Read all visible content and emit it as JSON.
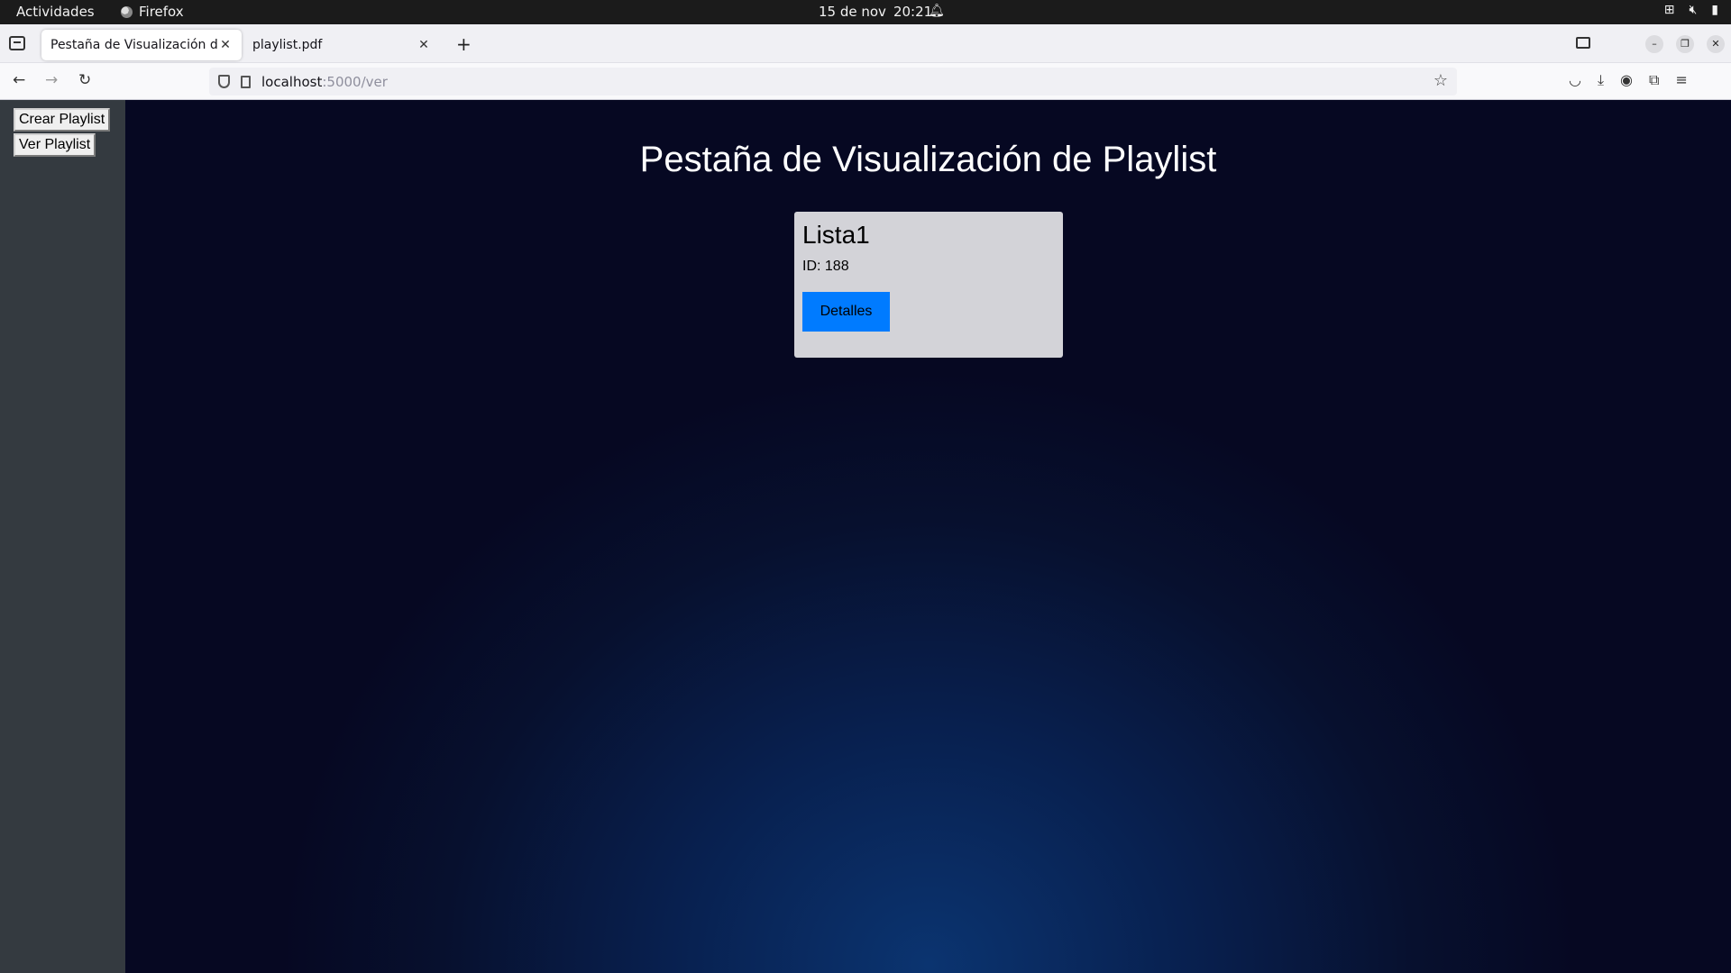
{
  "system_bar": {
    "activities": "Actividades",
    "app_name": "Firefox",
    "date": "15 de nov",
    "time": "20:21"
  },
  "browser": {
    "tabs": [
      {
        "title": "Pestaña de Visualización de Playlist",
        "active": true
      },
      {
        "title": "playlist.pdf",
        "active": false
      }
    ],
    "url_host": "localhost",
    "url_path": ":5000/ver"
  },
  "sidebar": {
    "create_label": "Crear Playlist",
    "view_label": "Ver Playlist"
  },
  "main": {
    "title": "Pestaña de Visualización de Playlist",
    "playlists": [
      {
        "name": "Lista1",
        "id_text": "ID: 188",
        "details_label": "Detalles"
      }
    ]
  },
  "colors": {
    "button_blue": "#007bff",
    "sidebar": "#343a40",
    "card": "#d3d3d8"
  }
}
